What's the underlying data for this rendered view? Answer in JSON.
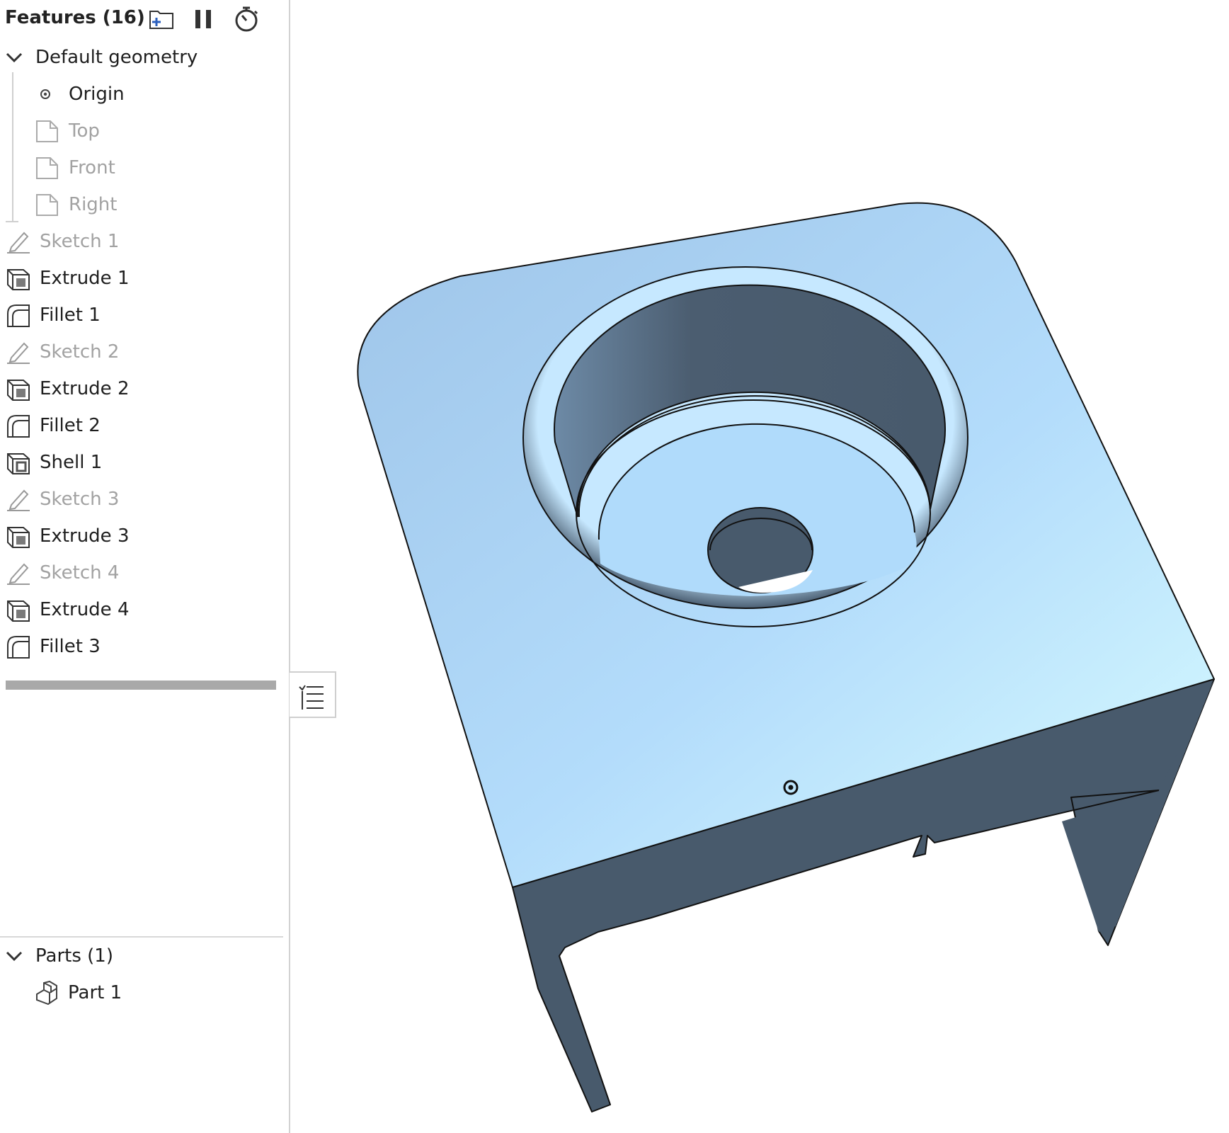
{
  "feature_panel": {
    "title": "Features (16)",
    "toolbar": {
      "add_folder_icon": "folder-plus-icon",
      "pause_icon": "pause-icon",
      "timer_icon": "stopwatch-icon"
    },
    "default_geometry": {
      "label": "Default geometry",
      "items": [
        {
          "label": "Origin",
          "icon": "origin-icon"
        },
        {
          "label": "Top",
          "icon": "plane-icon"
        },
        {
          "label": "Front",
          "icon": "plane-icon"
        },
        {
          "label": "Right",
          "icon": "plane-icon"
        }
      ]
    },
    "features": [
      {
        "label": "Sketch 1",
        "icon": "sketch-icon"
      },
      {
        "label": "Extrude 1",
        "icon": "extrude-icon"
      },
      {
        "label": "Fillet 1",
        "icon": "fillet-icon"
      },
      {
        "label": "Sketch 2",
        "icon": "sketch-icon"
      },
      {
        "label": "Extrude 2",
        "icon": "extrude-icon"
      },
      {
        "label": "Fillet 2",
        "icon": "fillet-icon"
      },
      {
        "label": "Shell 1",
        "icon": "shell-icon"
      },
      {
        "label": "Sketch 3",
        "icon": "sketch-icon"
      },
      {
        "label": "Extrude 3",
        "icon": "extrude-icon"
      },
      {
        "label": "Sketch 4",
        "icon": "sketch-icon"
      },
      {
        "label": "Extrude 4",
        "icon": "extrude-icon"
      },
      {
        "label": "Fillet 3",
        "icon": "fillet-icon"
      }
    ],
    "parts": {
      "label": "Parts (1)",
      "items": [
        {
          "label": "Part 1",
          "icon": "part-icon"
        }
      ]
    }
  },
  "colors": {
    "accent": "#2b5fbd",
    "face_light": "#b4dcfa",
    "face_dark": "#485a6c"
  }
}
